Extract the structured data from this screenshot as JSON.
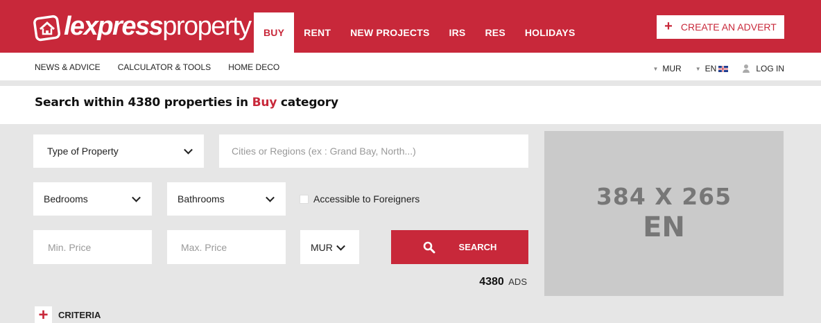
{
  "header": {
    "logo": {
      "bold": "lexpress",
      "light": "property"
    },
    "nav": [
      {
        "label": "BUY",
        "active": true
      },
      {
        "label": "RENT",
        "active": false
      },
      {
        "label": "NEW PROJECTS",
        "active": false
      },
      {
        "label": "IRS",
        "active": false
      },
      {
        "label": "RES",
        "active": false
      },
      {
        "label": "HOLIDAYS",
        "active": false
      }
    ],
    "create_advert": "CREATE AN ADVERT"
  },
  "subnav": {
    "items": [
      "NEWS & ADVICE",
      "CALCULATOR & TOOLS",
      "HOME DECO"
    ],
    "currency": "MUR",
    "language": "EN",
    "login": "LOG IN"
  },
  "title": {
    "prefix": "Search within 4380 properties in ",
    "category": "Buy",
    "suffix": " category"
  },
  "search": {
    "type_of_property": "Type of Property",
    "location_placeholder": "Cities or Regions (ex : Grand Bay, North...)",
    "bedrooms": "Bedrooms",
    "bathrooms": "Bathrooms",
    "foreigners_label": "Accessible to Foreigners",
    "min_price_placeholder": "Min. Price",
    "max_price_placeholder": "Max. Price",
    "currency": "MUR",
    "search_label": "SEARCH",
    "ads_count": "4380",
    "ads_label": "ADS",
    "criteria_label": "CRITERIA"
  },
  "ad_placeholder": {
    "size": "384 X 265",
    "lang": "EN"
  },
  "colors": {
    "brand_red": "#c8283a",
    "background": "#e6e6e6",
    "ad_grey": "#cacaca"
  }
}
